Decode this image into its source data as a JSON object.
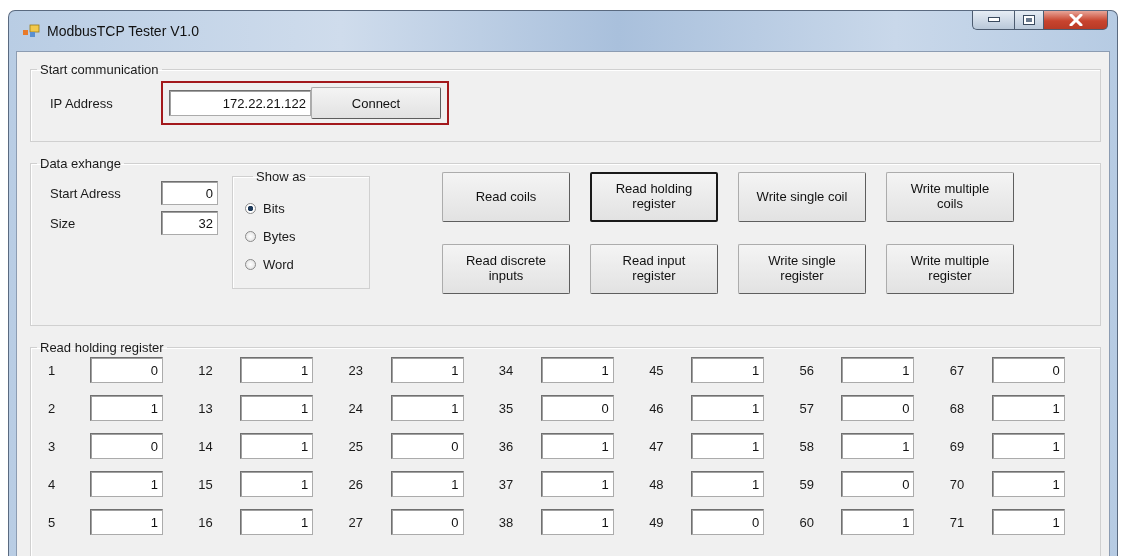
{
  "window": {
    "title": "ModbusTCP Tester V1.0"
  },
  "start_communication": {
    "title": "Start communication",
    "ip_label": "IP Address",
    "ip_value": "172.22.21.122",
    "connect_button": "Connect",
    "highlighted": true
  },
  "data_exchange": {
    "title": "Data exhange",
    "fields": [
      {
        "label": "Start Adress",
        "value": "0"
      },
      {
        "label": "Size",
        "value": "32"
      }
    ],
    "show_as": {
      "title": "Show as",
      "options": [
        {
          "label": "Bits",
          "selected": true
        },
        {
          "label": "Bytes",
          "selected": false
        },
        {
          "label": "Word",
          "selected": false
        }
      ]
    },
    "buttons": [
      {
        "label": "Read coils",
        "focused": false
      },
      {
        "label": "Read holding register",
        "focused": true
      },
      {
        "label": "Write single coil",
        "focused": false
      },
      {
        "label": "Write multiple coils",
        "focused": false
      },
      {
        "label": "Read discrete inputs",
        "focused": false
      },
      {
        "label": "Read input register",
        "focused": false
      },
      {
        "label": "Write single register",
        "focused": false
      },
      {
        "label": "Write multiple register",
        "focused": false
      }
    ]
  },
  "read_holding_register": {
    "title": "Read holding register",
    "columns": [
      [
        {
          "label": "1",
          "value": "0"
        },
        {
          "label": "2",
          "value": "1"
        },
        {
          "label": "3",
          "value": "0"
        },
        {
          "label": "4",
          "value": "1"
        },
        {
          "label": "5",
          "value": "1"
        }
      ],
      [
        {
          "label": "12",
          "value": "1"
        },
        {
          "label": "13",
          "value": "1"
        },
        {
          "label": "14",
          "value": "1"
        },
        {
          "label": "15",
          "value": "1"
        },
        {
          "label": "16",
          "value": "1"
        }
      ],
      [
        {
          "label": "23",
          "value": "1"
        },
        {
          "label": "24",
          "value": "1"
        },
        {
          "label": "25",
          "value": "0"
        },
        {
          "label": "26",
          "value": "1"
        },
        {
          "label": "27",
          "value": "0"
        }
      ],
      [
        {
          "label": "34",
          "value": "1"
        },
        {
          "label": "35",
          "value": "0"
        },
        {
          "label": "36",
          "value": "1"
        },
        {
          "label": "37",
          "value": "1"
        },
        {
          "label": "38",
          "value": "1"
        }
      ],
      [
        {
          "label": "45",
          "value": "1"
        },
        {
          "label": "46",
          "value": "1"
        },
        {
          "label": "47",
          "value": "1"
        },
        {
          "label": "48",
          "value": "1"
        },
        {
          "label": "49",
          "value": "0"
        }
      ],
      [
        {
          "label": "56",
          "value": "1"
        },
        {
          "label": "57",
          "value": "0"
        },
        {
          "label": "58",
          "value": "1"
        },
        {
          "label": "59",
          "value": "0"
        },
        {
          "label": "60",
          "value": "1"
        }
      ],
      [
        {
          "label": "67",
          "value": "0"
        },
        {
          "label": "68",
          "value": "1"
        },
        {
          "label": "69",
          "value": "1"
        },
        {
          "label": "70",
          "value": "1"
        },
        {
          "label": "71",
          "value": "1"
        }
      ]
    ]
  }
}
